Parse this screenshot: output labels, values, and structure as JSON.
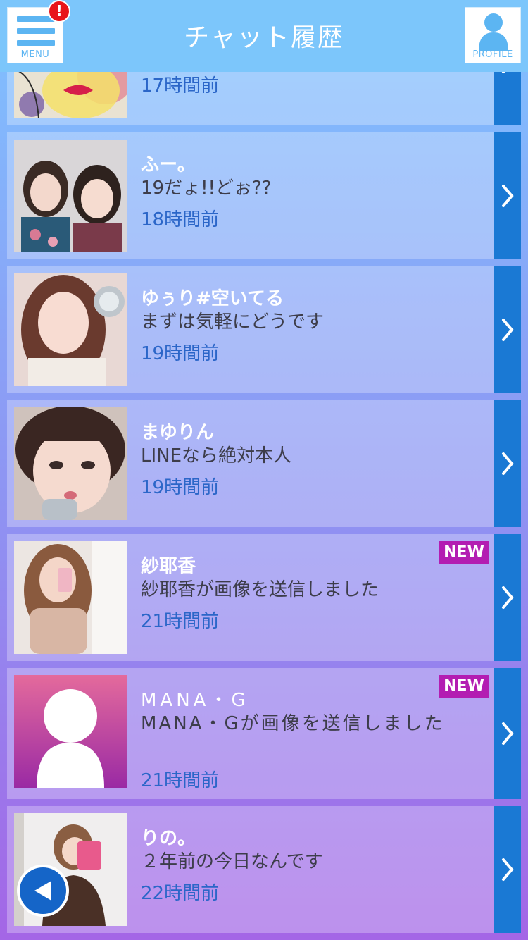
{
  "header": {
    "title": "チャット履歴",
    "menu_label": "MENU",
    "profile_label": "PROFILE",
    "alert_mark": "!"
  },
  "chats": [
    {
      "name": "",
      "message": "",
      "time": "17時間前",
      "is_new": false
    },
    {
      "name": "ふー。",
      "message": "19だょ!!どぉ??",
      "time": "18時間前",
      "is_new": false
    },
    {
      "name": "ゆぅり#空いてる",
      "message": "まずは気軽にどうです",
      "time": "19時間前",
      "is_new": false
    },
    {
      "name": "まゆりん",
      "message": "LINEなら絶対本人",
      "time": "19時間前",
      "is_new": false
    },
    {
      "name": "紗耶香",
      "message": "紗耶香が画像を送信しました",
      "time": "21時間前",
      "is_new": true,
      "badge": "NEW"
    },
    {
      "name": "MANA・G",
      "message": "MANA・Gが画像を送信しました",
      "time": "21時間前",
      "is_new": true,
      "badge": "NEW"
    },
    {
      "name": "りの。",
      "message": "２年前の今日なんです",
      "time": "22時間前",
      "is_new": false
    }
  ],
  "icons": {
    "menu": "hamburger-icon",
    "profile": "person-icon",
    "row_arrow": "chevron-right-icon",
    "back": "back-triangle-icon",
    "alert": "alert-badge-icon"
  },
  "colors": {
    "header_bg": "#7cc6fb",
    "arrow_column": "#1a79d4",
    "new_badge": "#b31db2",
    "time_text": "#2b66c8",
    "alert_red": "#e8141a"
  }
}
